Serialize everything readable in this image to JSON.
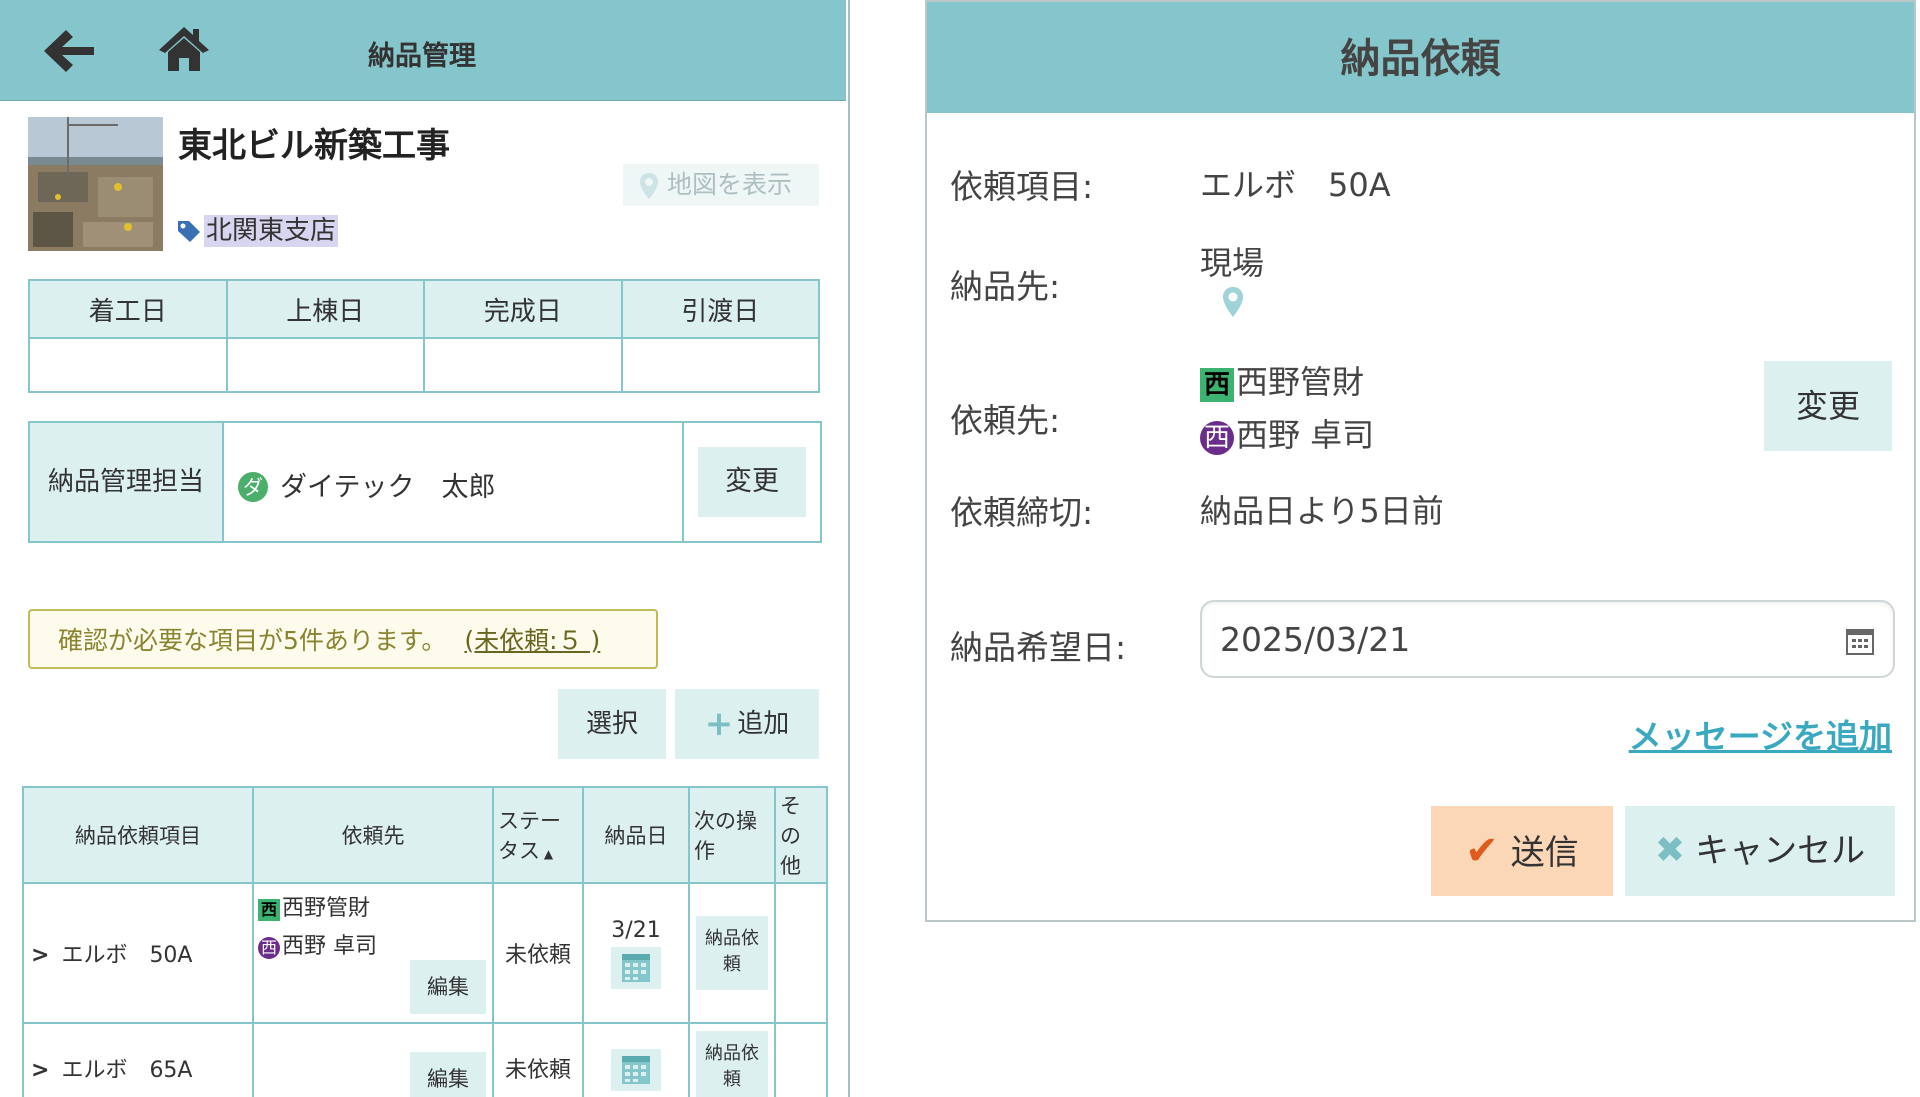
{
  "left": {
    "header": {
      "title": "納品管理",
      "back_icon": "back-arrow-icon",
      "home_icon": "home-icon"
    },
    "project": {
      "name": "東北ビル新築工事",
      "map_button": "地図を表示",
      "branch": "北関東支店"
    },
    "dates": {
      "headers": [
        "着工日",
        "上棟日",
        "完成日",
        "引渡日"
      ],
      "values": [
        "",
        "",
        "",
        ""
      ]
    },
    "manager": {
      "label": "納品管理担当",
      "icon_text": "ダ",
      "person": "ダイテック　太郎",
      "change_button": "変更"
    },
    "notice": {
      "text": "確認が必要な項目が5件あります。",
      "link": "(未依頼:５ )"
    },
    "actions": {
      "select": "選択",
      "add": "追加"
    },
    "table": {
      "headers": [
        "納品依頼項目",
        "依頼先",
        "ステー タス",
        "納品日",
        "次の操 作",
        "そ の 他"
      ],
      "rows": [
        {
          "item": "エルボ　50A",
          "corp_tag": "西",
          "corp": "西野管財",
          "person_tag": "西",
          "person": "西野 卓司",
          "edit": "編集",
          "status": "未依頼",
          "date": "3/21",
          "next": "納品依 頼"
        },
        {
          "item": "エルボ　65A",
          "corp_tag": "",
          "corp": "",
          "person_tag": "",
          "person": "",
          "edit": "編集",
          "status": "未依頼",
          "date": "",
          "next": "納品依 頼"
        }
      ]
    }
  },
  "dialog": {
    "title": "納品依頼",
    "fields": {
      "item_label": "依頼項目:",
      "item_value": "エルボ　50A",
      "dest_label": "納品先:",
      "dest_value": "現場",
      "req_label": "依頼先:",
      "req_corp_tag": "西",
      "req_corp": "西野管財",
      "req_person_tag": "西",
      "req_person": "西野 卓司",
      "change_button": "変更",
      "deadline_label": "依頼締切:",
      "deadline_value": "納品日より5日前",
      "date_label": "納品希望日:",
      "date_value": "2025/03/21"
    },
    "message_link": "メッセージを追加",
    "send_button": "送信",
    "cancel_button": "キャンセル"
  },
  "colors": {
    "header": "#84c6cb",
    "cell": "#ddf0f0",
    "status_red": "#e0201c",
    "send_bg": "#fbd7b8",
    "link": "#3aa8c0"
  }
}
